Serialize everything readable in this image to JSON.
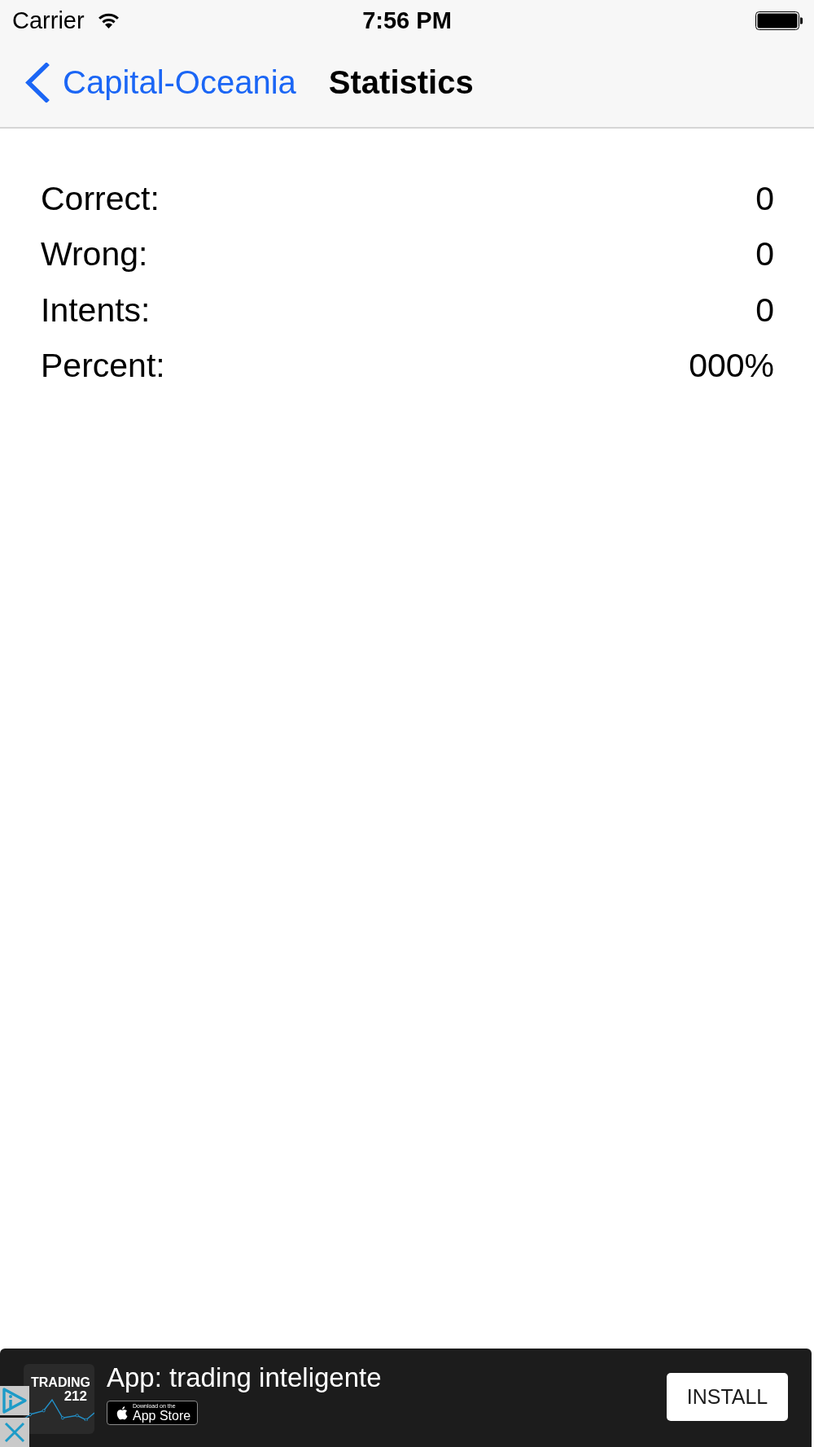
{
  "status_bar": {
    "carrier": "Carrier",
    "time": "7:56 PM"
  },
  "nav_bar": {
    "back_label": "Capital-Oceania",
    "title": "Statistics"
  },
  "stats": [
    {
      "label": "Correct:",
      "value": "0"
    },
    {
      "label": "Wrong:",
      "value": "0"
    },
    {
      "label": "Intents:",
      "value": "0"
    },
    {
      "label": "Percent:",
      "value": "000%"
    }
  ],
  "ad_banner": {
    "logo_lines": [
      "TRADING",
      "212"
    ],
    "title": "App: trading inteligente",
    "store_badge": {
      "line_1": "Download on the",
      "line_2": "App Store"
    },
    "button": "INSTALL"
  }
}
